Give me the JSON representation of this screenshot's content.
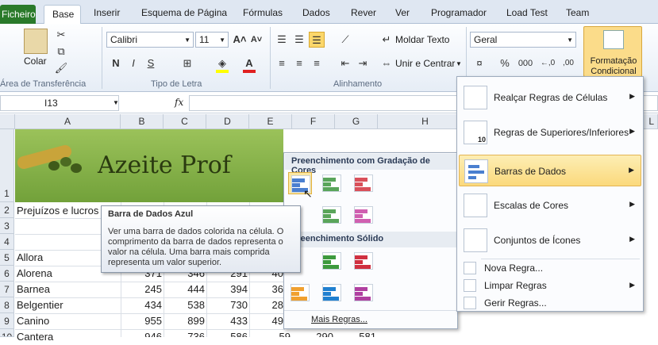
{
  "tabs": {
    "file": "Ficheiro",
    "items": [
      "Base",
      "Inserir",
      "Esquema de Página",
      "Fórmulas",
      "Dados",
      "Rever",
      "Ver",
      "Programador",
      "Load Test",
      "Team"
    ]
  },
  "ribbon": {
    "paste": "Colar",
    "font_name": "Calibri",
    "font_size": "11",
    "wrap_text": "Moldar Texto",
    "merge_center": "Unir e Centrar",
    "number_format": "Geral",
    "percent": "%",
    "thousands": "000",
    "cond_format_l1": "Formatação",
    "cond_format_l2": "Condicional",
    "groups": {
      "clipboard": "Área de Transferência",
      "font": "Tipo de Letra",
      "alignment": "Alinhamento"
    },
    "bold": "N",
    "italic": "I",
    "underline": "S"
  },
  "formula_bar": {
    "name_box": "I13",
    "fx": "fx"
  },
  "columns": [
    "A",
    "B",
    "C",
    "D",
    "E",
    "F",
    "G",
    "H",
    "L"
  ],
  "rows": [
    "1",
    "2",
    "3",
    "4",
    "5",
    "6",
    "7",
    "8",
    "9",
    "10"
  ],
  "banner_title": "Azeite Prof",
  "cells": {
    "a2": "Prejuízos e lucros",
    "names": [
      "Allora",
      "Alorena",
      "Barnea",
      "Belgentier",
      "Canino",
      "Cantera"
    ],
    "row6": [
      "371",
      "346",
      "291",
      "40"
    ],
    "row7": [
      "245",
      "444",
      "394",
      "36"
    ],
    "row8": [
      "434",
      "538",
      "730",
      "28"
    ],
    "row9": [
      "955",
      "899",
      "433",
      "49"
    ],
    "row10": [
      "946",
      "736",
      "586",
      "59",
      "290",
      "581"
    ]
  },
  "gallery": {
    "gradient_header": "Preenchimento com Gradação de Cores",
    "solid_header": "Preenchimento Sólido",
    "more_rules": "Mais Regras..."
  },
  "tooltip": {
    "title": "Barra de Dados Azul",
    "body": "Ver uma barra de dados colorida na célula. O comprimento da barra de dados representa o valor na célula. Uma barra mais comprida representa um valor superior."
  },
  "cf_menu": {
    "items": [
      "Realçar Regras de Células",
      "Regras de Superiores/Inferiores",
      "Barras de Dados",
      "Escalas de Cores",
      "Conjuntos de Ícones"
    ],
    "small": [
      "Nova Regra...",
      "Limpar Regras",
      "Gerir Regras..."
    ],
    "topbottom_icon_num": "10"
  },
  "colors": {
    "blue": "#4a7fd0",
    "green": "#5aa55a",
    "red": "#d9505a",
    "orange": "#f0a030",
    "highlight": "#fbe7a2"
  }
}
